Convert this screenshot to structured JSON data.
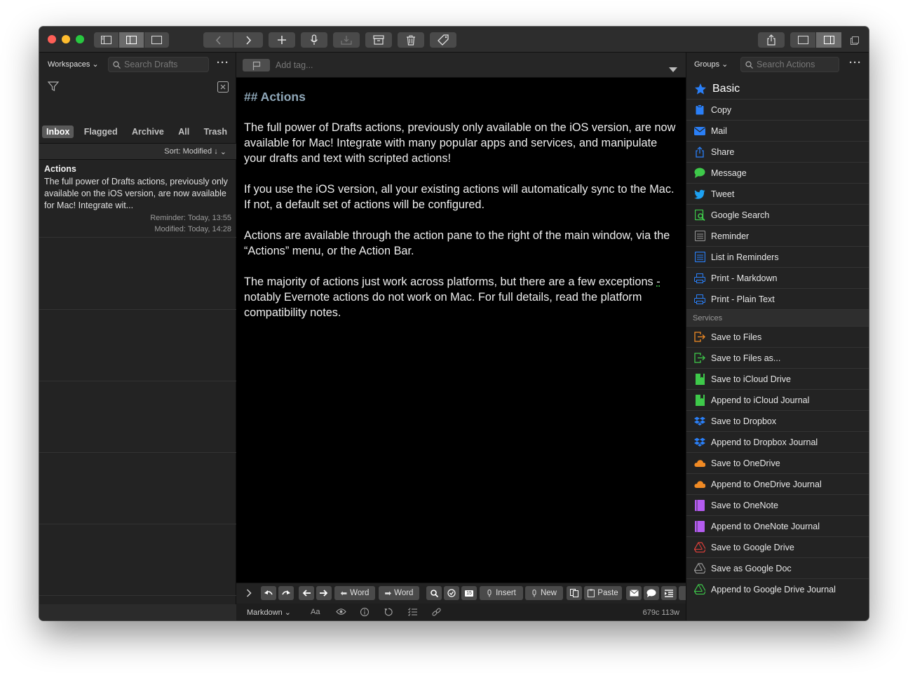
{
  "colors": {
    "traffic_close": "#fe5f57",
    "traffic_min": "#febc2e",
    "traffic_max": "#28c840",
    "heading": "#8fa7b8",
    "star_blue": "#2a7ff7"
  },
  "toolbar": {
    "icons": [
      "sidebar-icon",
      "split-view-icon",
      "single-view-icon",
      "back-icon",
      "forward-icon",
      "new-draft-icon",
      "dictate-icon",
      "archive-inbox-icon",
      "archive-box-icon",
      "trash-icon",
      "tag-icon",
      "share-icon",
      "editor-only-icon",
      "action-pane-icon",
      "window-icon"
    ]
  },
  "left": {
    "workspaces_label": "Workspaces",
    "search_placeholder": "Search Drafts",
    "tabs": [
      "Inbox",
      "Flagged",
      "Archive",
      "All",
      "Trash"
    ],
    "sort_label": "Sort: Modified ↓",
    "draft": {
      "title": "Actions",
      "body": "The full power of Drafts actions, previously only available on the iOS version, are now available for Mac! Integrate wit...",
      "reminder": "Reminder: Today, 13:55",
      "modified": "Modified: Today, 14:28"
    }
  },
  "editor": {
    "tag_placeholder": "Add tag...",
    "heading": "## Actions",
    "paragraphs": [
      "The full power of Drafts actions, previously only available on the iOS version, are now available for Mac! Integrate with many popular apps and services, and manipulate your drafts and text with scripted actions!",
      "If you use the iOS version, all your existing actions will automatically sync to the Mac. If not, a default set of actions will be configured.",
      "Actions are available through the action pane to the right of the main window, via the “Actions” menu, or the Action Bar."
    ],
    "p4_a": "The majority of actions just work across platforms, but there are a few exceptions ",
    "p4_dash": "-",
    "p4_b": " notably Evernote actions do not work on Mac. For full details, read the platform compatibility notes.",
    "actionbar": {
      "word_left": "Word",
      "word_right": "Word",
      "calendar_day": "15",
      "insert": "Insert",
      "new": "New",
      "paste": "Paste"
    },
    "status": {
      "mode": "Markdown",
      "font": "Aa",
      "counts": "679c 113w"
    }
  },
  "right": {
    "groups_label": "Groups",
    "search_placeholder": "Search Actions",
    "group_title": "Basic",
    "basic_actions": [
      {
        "label": "Copy",
        "icon": "clipboard-icon",
        "color": "#2a7ff7"
      },
      {
        "label": "Mail",
        "icon": "mail-icon",
        "color": "#2a7ff7"
      },
      {
        "label": "Share",
        "icon": "share-icon",
        "color": "#2a7ff7"
      },
      {
        "label": "Message",
        "icon": "message-icon",
        "color": "#3ec94a"
      },
      {
        "label": "Tweet",
        "icon": "twitter-icon",
        "color": "#1da1f2"
      },
      {
        "label": "Google Search",
        "icon": "search-icon",
        "color": "#3ec94a"
      },
      {
        "label": "Reminder",
        "icon": "reminder-icon",
        "color": "#9a9a9a"
      },
      {
        "label": "List in Reminders",
        "icon": "list-icon",
        "color": "#2a7ff7"
      },
      {
        "label": "Print - Markdown",
        "icon": "printer-icon",
        "color": "#2a7ff7"
      },
      {
        "label": "Print - Plain Text",
        "icon": "printer-icon",
        "color": "#2a7ff7"
      }
    ],
    "services_label": "Services",
    "service_actions": [
      {
        "label": "Save to Files",
        "icon": "export-icon",
        "color": "#f08a24"
      },
      {
        "label": "Save to Files as...",
        "icon": "export-icon",
        "color": "#3ec94a"
      },
      {
        "label": "Save to iCloud Drive",
        "icon": "bookmark-icon",
        "color": "#3ec94a"
      },
      {
        "label": "Append to iCloud Journal",
        "icon": "bookmark-icon",
        "color": "#3ec94a"
      },
      {
        "label": "Save to Dropbox",
        "icon": "dropbox-icon",
        "color": "#2a7ff7"
      },
      {
        "label": "Append to Dropbox Journal",
        "icon": "dropbox-icon",
        "color": "#2a7ff7"
      },
      {
        "label": "Save to OneDrive",
        "icon": "cloud-icon",
        "color": "#f08a24"
      },
      {
        "label": "Append to OneDrive Journal",
        "icon": "cloud-icon",
        "color": "#f08a24"
      },
      {
        "label": "Save to OneNote",
        "icon": "notebook-icon",
        "color": "#b45cf0"
      },
      {
        "label": "Append to OneNote Journal",
        "icon": "notebook-icon",
        "color": "#b45cf0"
      },
      {
        "label": "Save to Google Drive",
        "icon": "drive-icon",
        "color": "#e0403a"
      },
      {
        "label": "Save as Google Doc",
        "icon": "drive-icon",
        "color": "#9a9a9a"
      },
      {
        "label": "Append to Google Drive Journal",
        "icon": "drive-icon",
        "color": "#3ec94a"
      }
    ]
  }
}
